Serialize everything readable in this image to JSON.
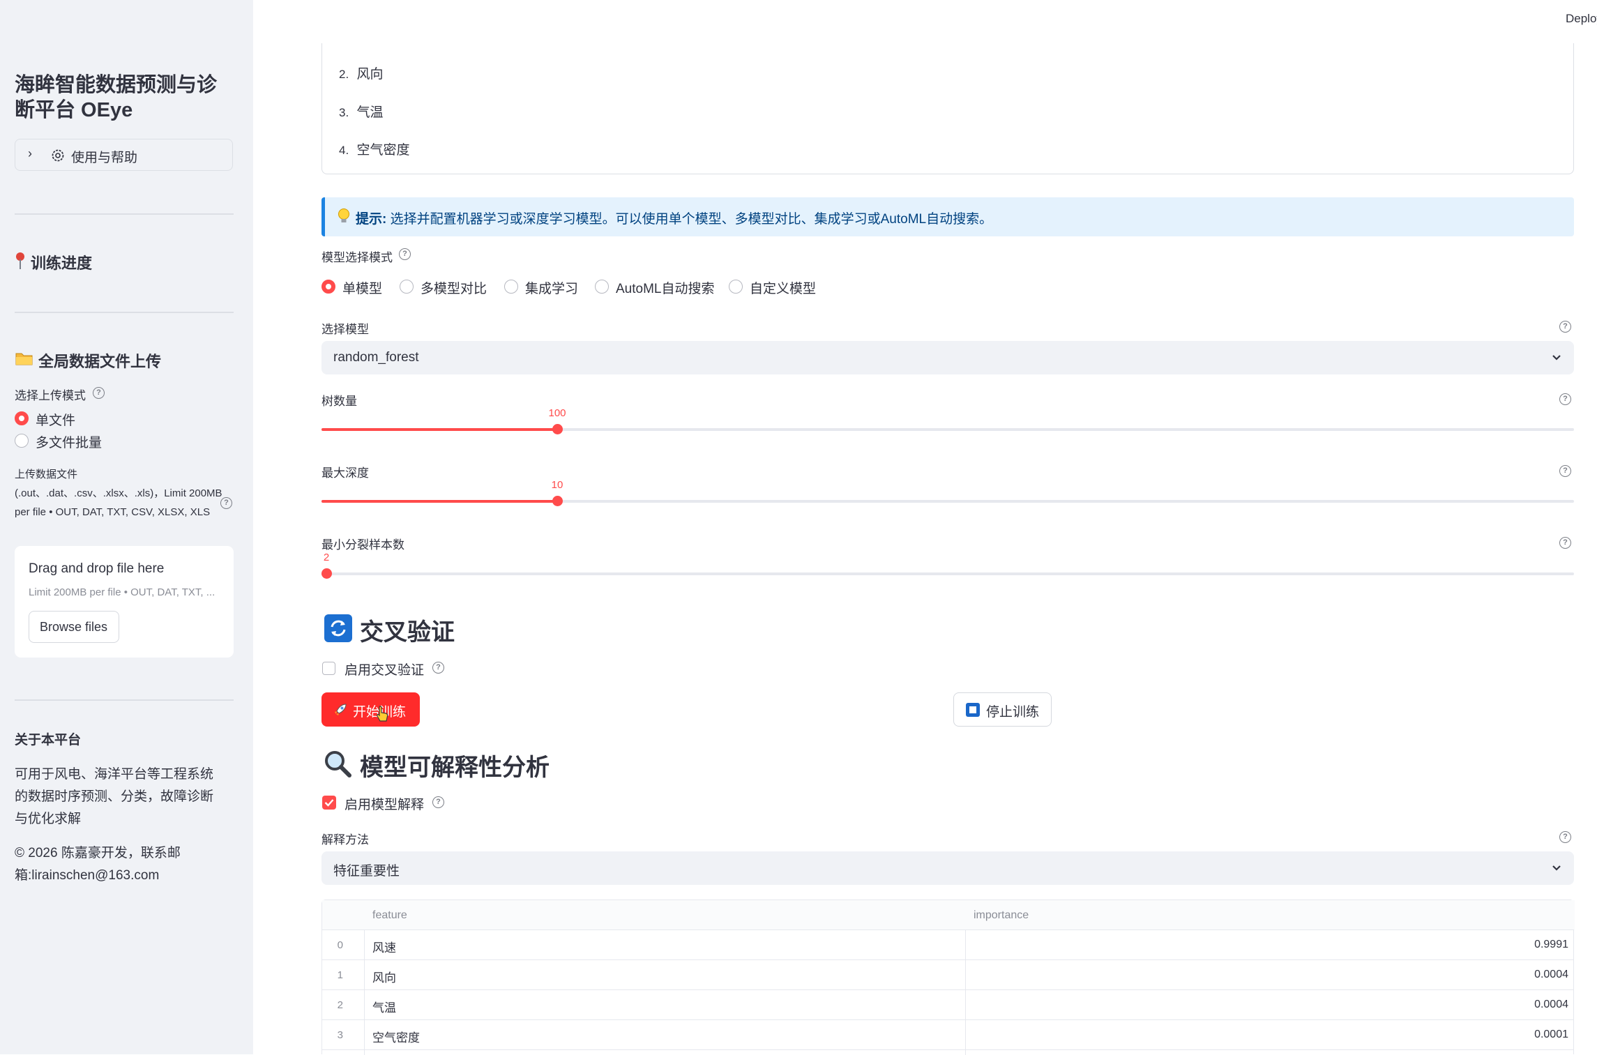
{
  "header": {
    "deploy_label": "Deploy"
  },
  "sidebar": {
    "title": "海眸智能数据预测与诊断平台 OEye",
    "help_expander": "使用与帮助",
    "training_progress": "训练进度",
    "upload_section": "全局数据文件上传",
    "upload_mode_label": "选择上传模式",
    "upload_modes": [
      "单文件",
      "多文件批量"
    ],
    "upload_mode_selected": "单文件",
    "upload_file_label": "上传数据文件 (.out、.dat、.csv、.xlsx、.xls)，Limit 200MB per file • OUT, DAT, TXT, CSV, XLSX, XLS",
    "dropzone_title": "Drag and drop file here",
    "dropzone_hint": "Limit 200MB per file • OUT, DAT, TXT, ...",
    "browse_button": "Browse files",
    "about_title": "关于本平台",
    "about_text": "可用于风电、海洋平台等工程系统的数据时序预测、分类，故障诊断与优化求解",
    "copyright": "© 2026 陈嘉豪开发，联系邮箱:lirainschen@163.com"
  },
  "features_list": [
    {
      "num": "2.",
      "name": "风向"
    },
    {
      "num": "3.",
      "name": "气温"
    },
    {
      "num": "4.",
      "name": "空气密度"
    }
  ],
  "tip": {
    "bold": "提示:",
    "text": " 选择并配置机器学习或深度学习模型。可以使用单个模型、多模型对比、集成学习或AutoML自动搜索。"
  },
  "model_mode": {
    "label": "模型选择模式",
    "options": [
      "单模型",
      "多模型对比",
      "集成学习",
      "AutoML自动搜索",
      "自定义模型"
    ],
    "selected": "单模型"
  },
  "model_select": {
    "label": "选择模型",
    "value": "random_forest"
  },
  "sliders": {
    "n_trees": {
      "label": "树数量",
      "value": "100",
      "fraction": 0.186
    },
    "max_depth": {
      "label": "最大深度",
      "value": "10",
      "fraction": 0.186
    },
    "min_split": {
      "label": "最小分裂样本数",
      "value": "2",
      "fraction": 0.0
    }
  },
  "cv": {
    "heading": "交叉验证",
    "checkbox_label": "启用交叉验证",
    "checked": false
  },
  "buttons": {
    "start": "开始训练",
    "stop": "停止训练"
  },
  "explain": {
    "heading": "模型可解释性分析",
    "checkbox_label": "启用模型解释",
    "checked": true,
    "method_label": "解释方法",
    "method_value": "特征重要性"
  },
  "table": {
    "columns": [
      "feature",
      "importance"
    ],
    "rows": [
      {
        "index": "0",
        "feature": "风速",
        "importance": "0.9991"
      },
      {
        "index": "1",
        "feature": "风向",
        "importance": "0.0004"
      },
      {
        "index": "2",
        "feature": "气温",
        "importance": "0.0004"
      },
      {
        "index": "3",
        "feature": "空气密度",
        "importance": "0.0001"
      }
    ]
  },
  "colors": {
    "accent": "#ff4b4b",
    "info_bg": "#e4f2fd",
    "info_border": "#1c83e1",
    "sidebar_bg": "#f0f2f6"
  }
}
